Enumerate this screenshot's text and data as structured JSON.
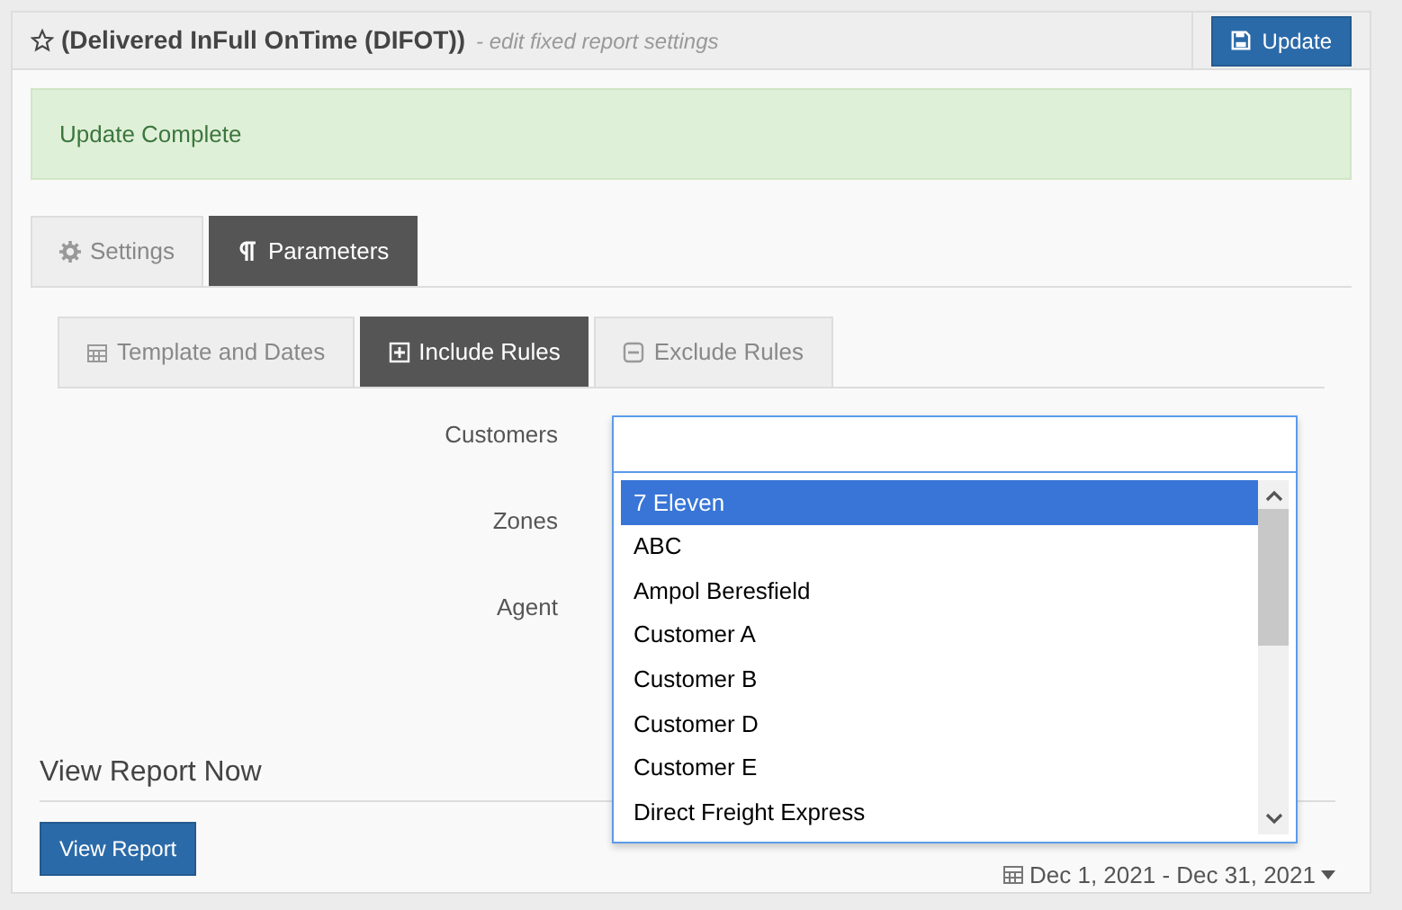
{
  "header": {
    "title": "(Delivered InFull OnTime (DIFOT))",
    "subtitle": "- edit fixed report settings",
    "update_button": "Update"
  },
  "alert": "Update Complete",
  "tabs": [
    {
      "label": "Settings",
      "kind": "gear",
      "selected": false
    },
    {
      "label": "Parameters",
      "kind": "pilcrow",
      "selected": true
    }
  ],
  "subtabs": [
    {
      "label": "Template and Dates",
      "kind": "calendar",
      "selected": false
    },
    {
      "label": "Include Rules",
      "kind": "plus",
      "selected": true
    },
    {
      "label": "Exclude Rules",
      "kind": "minus",
      "selected": false
    }
  ],
  "fields": [
    "Customers",
    "Zones",
    "Agent"
  ],
  "dropdown": {
    "options": [
      {
        "label": "7 Eleven",
        "selected": true
      },
      {
        "label": "ABC",
        "selected": false
      },
      {
        "label": "Ampol Beresfield",
        "selected": false
      },
      {
        "label": "Customer A",
        "selected": false
      },
      {
        "label": "Customer B",
        "selected": false
      },
      {
        "label": "Customer D",
        "selected": false
      },
      {
        "label": "Customer E",
        "selected": false
      },
      {
        "label": "Direct Freight Express",
        "selected": false
      }
    ]
  },
  "view_report": {
    "heading": "View Report Now",
    "button": "View Report",
    "date_range": "Dec 1, 2021 - Dec 31, 2021"
  }
}
